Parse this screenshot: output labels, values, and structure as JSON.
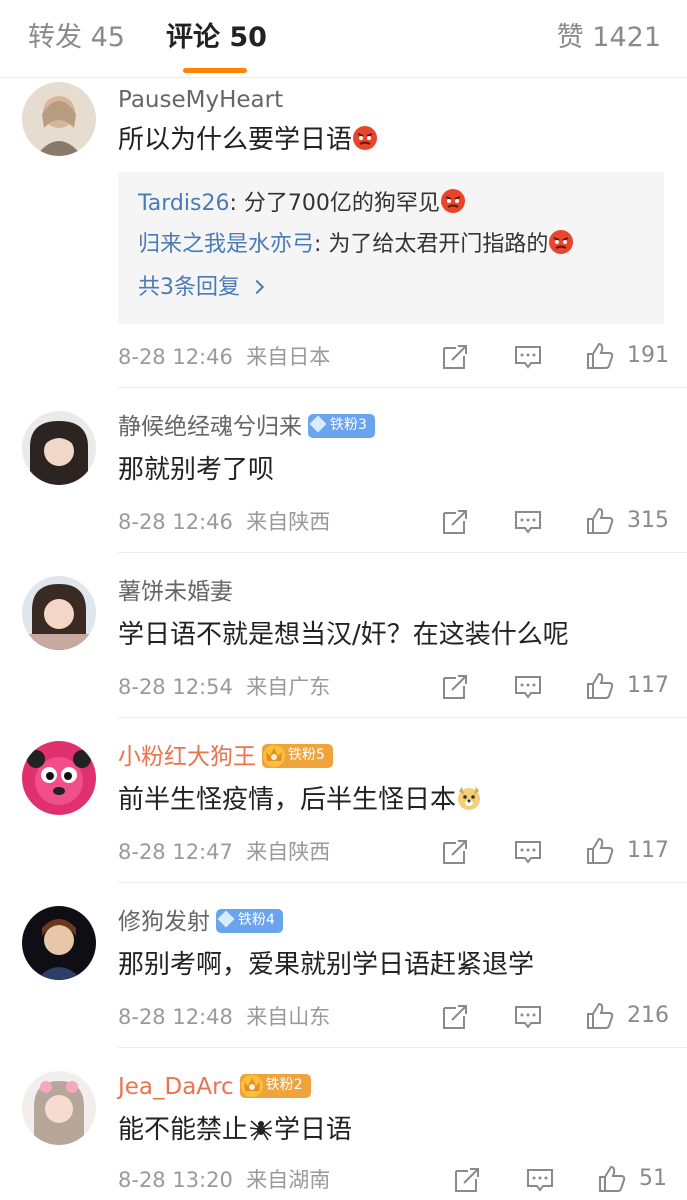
{
  "tabs": {
    "repost": "转发 45",
    "comment": "评论 50",
    "like": "赞 1421",
    "accent": "#ff8200"
  },
  "comments": [
    {
      "user": "PauseMyHeart",
      "text": "所以为什么要学日语",
      "emoji": "angry-face-emoji",
      "replies": [
        {
          "name": "Tardis26",
          "sep": ": ",
          "text": "分了700亿的狗罕见",
          "emoji": "angry-face-emoji"
        },
        {
          "name": "归来之我是水亦弓",
          "sep": ": ",
          "text": "为了给太君开门指路的",
          "emoji": "angry-face-emoji"
        }
      ],
      "more_replies": "共3条回复",
      "time": "8-28 12:46",
      "location": "来自日本",
      "likes": "191"
    },
    {
      "user": "静候绝经魂兮归来",
      "badge": "铁粉3",
      "text": "那就别考了呗",
      "time": "8-28 12:46",
      "location": "来自陕西",
      "likes": "315"
    },
    {
      "user": "薯饼未婚妻",
      "text": "学日语不就是想当汉/奸？在这装什么呢",
      "time": "8-28 12:54",
      "location": "来自广东",
      "likes": "117"
    },
    {
      "user": "小粉红大狗王",
      "badge": "铁粉5",
      "text": "前半生怪疫情，后半生怪日本",
      "emoji": "doge-emoji",
      "time": "8-28 12:47",
      "location": "来自陕西",
      "likes": "117"
    },
    {
      "user": "修狗发射",
      "badge": "铁粉4",
      "text": "那别考啊，爱果就别学日语赶紧退学",
      "time": "8-28 12:48",
      "location": "来自山东",
      "likes": "216"
    },
    {
      "user": "Jea_DaArc",
      "badge": "铁粉2",
      "text_before": "能不能禁止",
      "emoji": "spider-emoji",
      "text_after": "学日语",
      "time": "8-28 13:20",
      "location": "来自湖南",
      "likes": "51"
    }
  ]
}
